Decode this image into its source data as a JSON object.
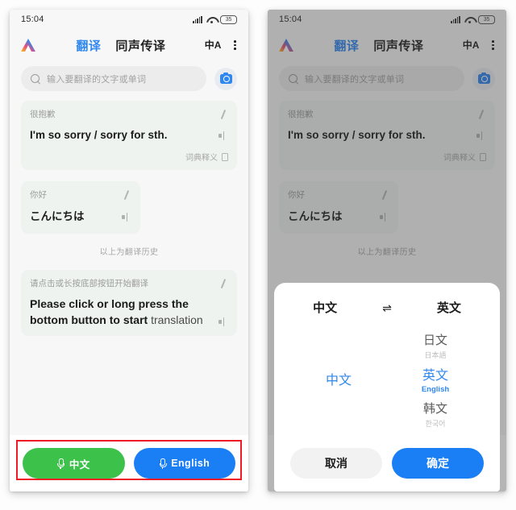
{
  "status_bar": {
    "time": "15:04",
    "signal_icon": "signal-bars-icon",
    "wifi_icon": "wifi-icon",
    "battery_level": "35"
  },
  "app_bar": {
    "logo_icon": "app-logo-icon",
    "tabs": [
      {
        "label": "翻译",
        "active": true
      },
      {
        "label": "同声传译",
        "active": false
      }
    ],
    "lang_toggle_icon": "中A",
    "more_icon": "more-vertical-icon"
  },
  "search": {
    "icon": "search-icon",
    "placeholder": "输入要翻译的文字或单词",
    "camera_icon": "camera-icon"
  },
  "history": {
    "cards": [
      {
        "source": "很抱歉",
        "translation": "I'm so sorry / sorry for sth.",
        "edit_icon": "edit-slash-icon",
        "speaker_icon": "speaker-icon",
        "footer_label": "词典释义",
        "footer_icon": "book-icon"
      },
      {
        "source": "你好",
        "translation": "こんにちは",
        "edit_icon": "edit-slash-icon",
        "speaker_icon": "speaker-icon"
      }
    ],
    "note": "以上为翻译历史"
  },
  "current_card": {
    "source": "请点击或长按底部按钮开始翻译",
    "translation_main": "Please click or long press the bottom button to start",
    "translation_tail": "translation",
    "edit_icon": "edit-slash-icon",
    "speaker_icon": "speaker-icon"
  },
  "bottom_bar": {
    "buttons": [
      {
        "label": "中文",
        "color": "#3cc14b",
        "mic_icon": "mic-icon"
      },
      {
        "label": "English",
        "color": "#1a7ef5",
        "mic_icon": "mic-icon"
      }
    ],
    "highlight_color": "#ee1b24"
  },
  "dialog": {
    "header": {
      "source_lang": "中文",
      "swap_icon": "⇌",
      "target_lang": "英文"
    },
    "source_picker": [
      {
        "zh": "中文",
        "native": "",
        "selected": true
      }
    ],
    "target_picker": [
      {
        "zh": "日文",
        "native": "日本語",
        "selected": false
      },
      {
        "zh": "英文",
        "native": "English",
        "selected": true
      },
      {
        "zh": "韩文",
        "native": "한국어",
        "selected": false
      }
    ],
    "cancel_label": "取消",
    "confirm_label": "确定",
    "confirm_color": "#1a7ef5"
  },
  "accents": {
    "tab_active": "#2f87f0",
    "card_bg": "#eef3ef"
  }
}
